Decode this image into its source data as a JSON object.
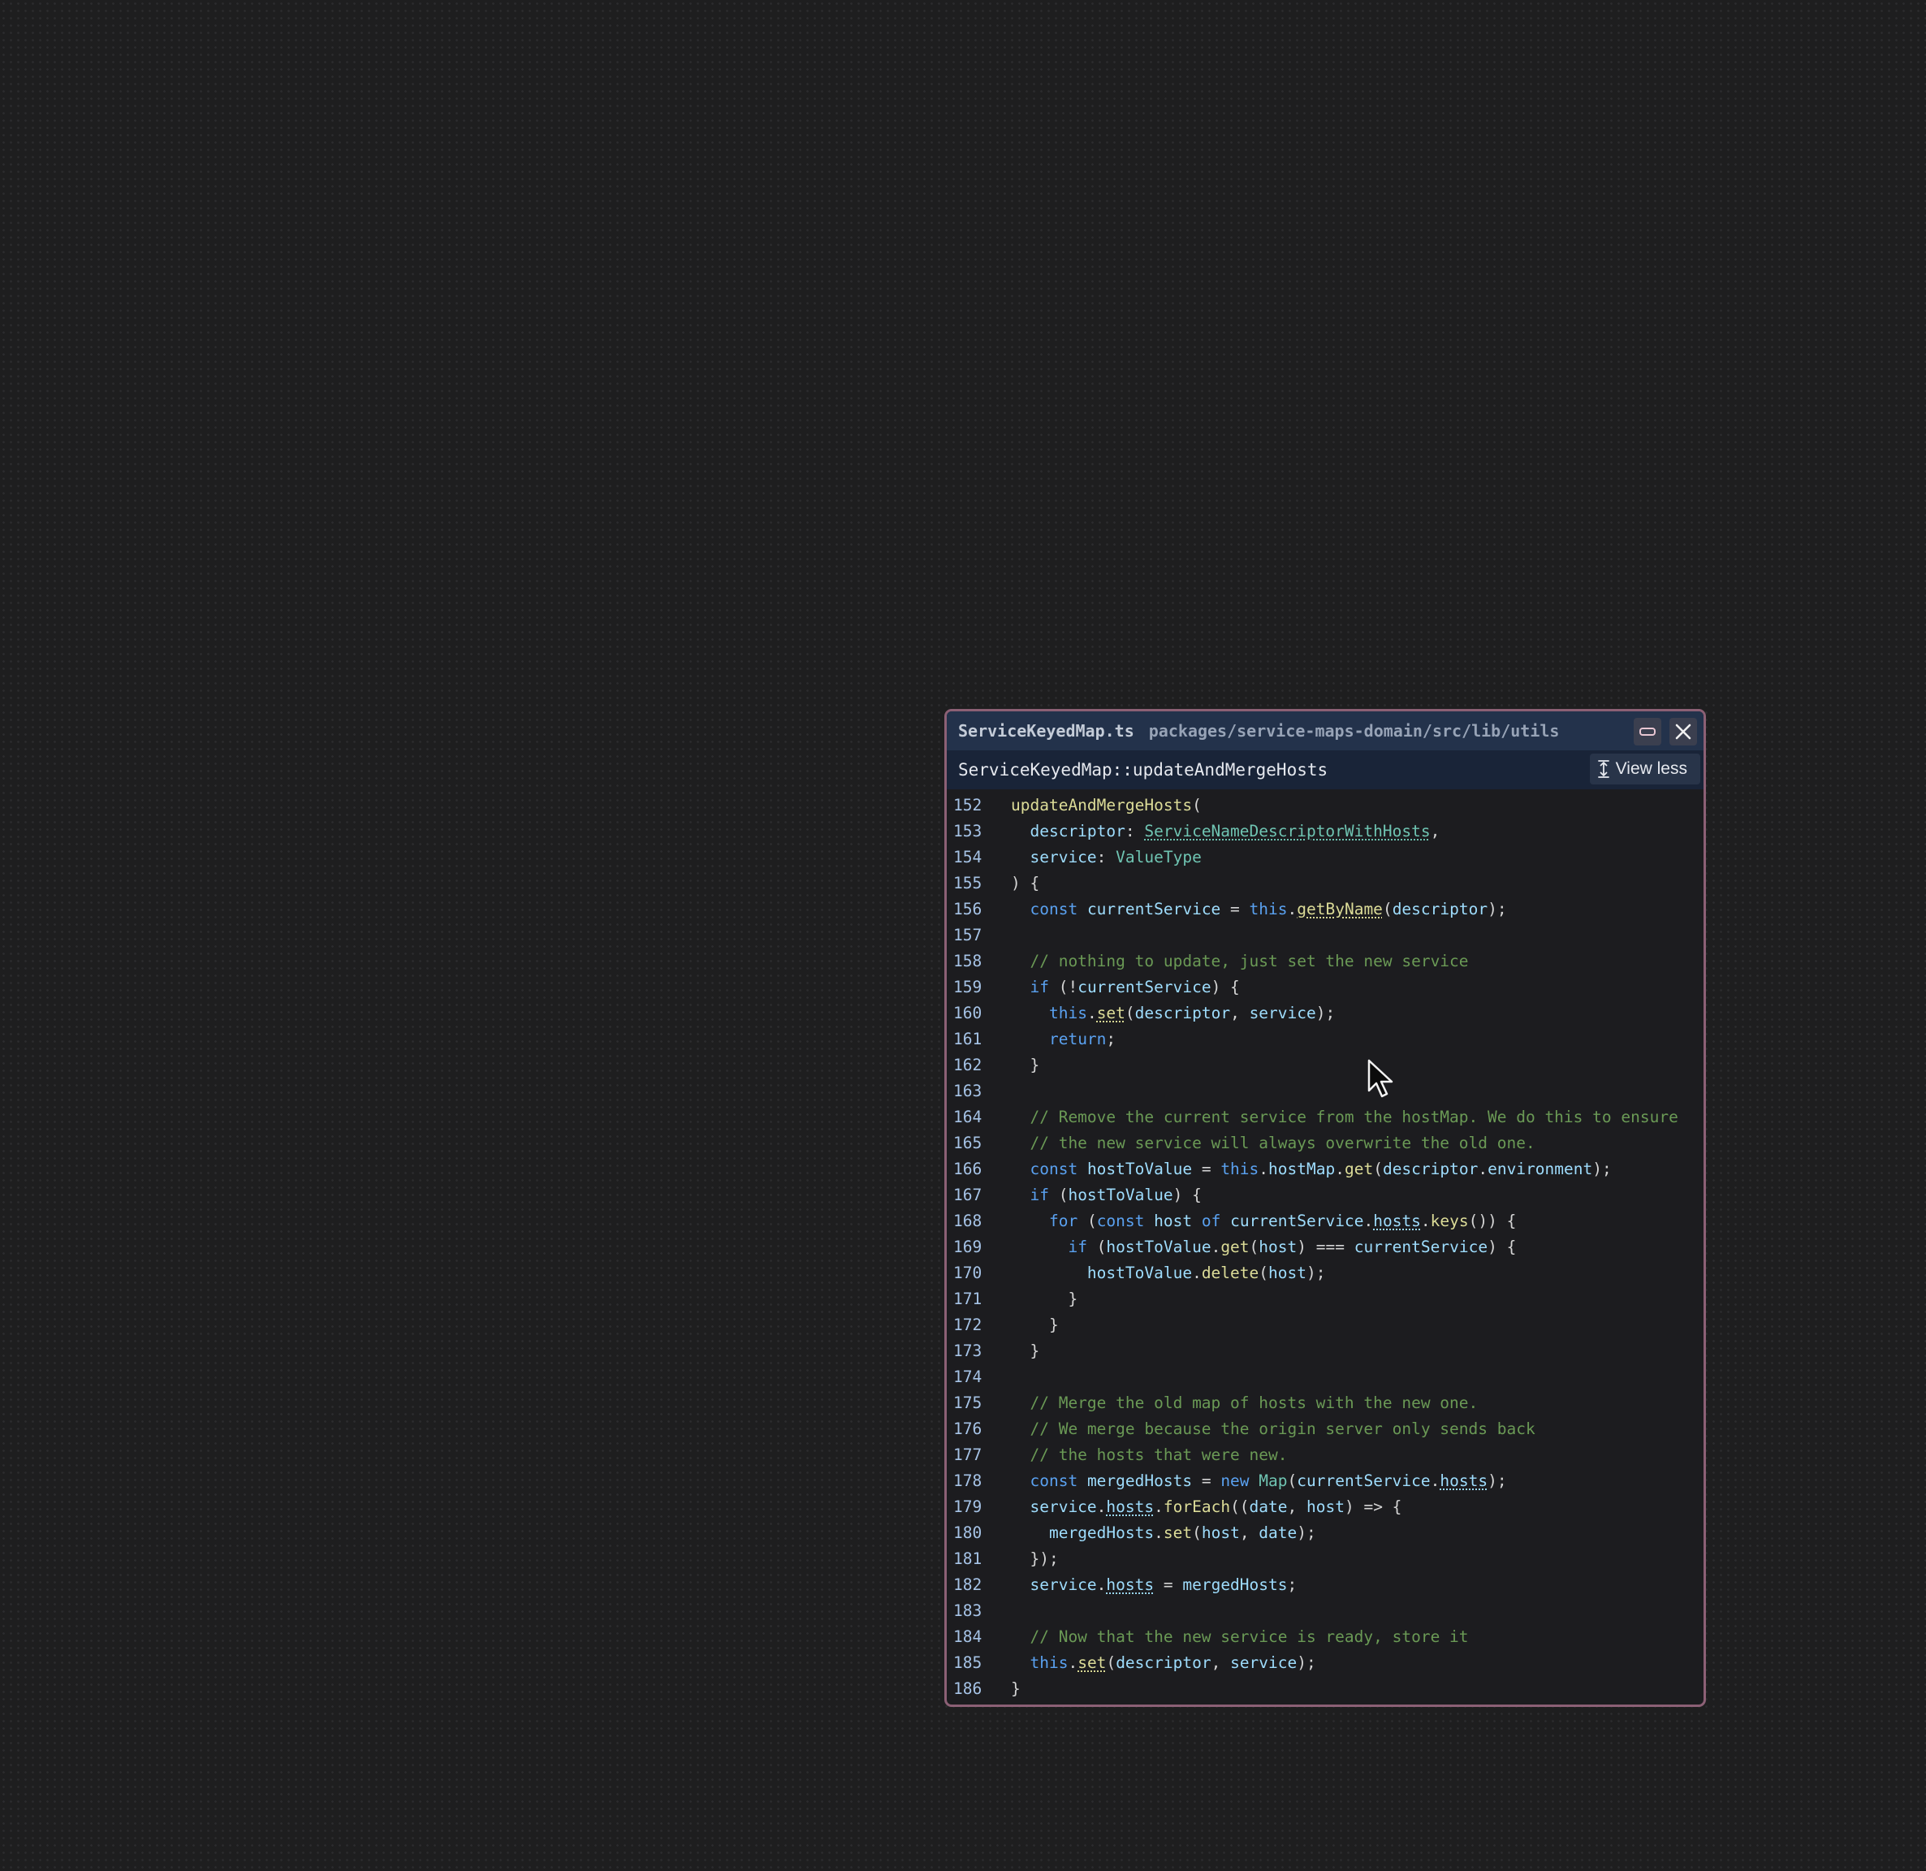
{
  "window": {
    "file_name": "ServiceKeyedMap.ts",
    "file_path": "packages/service-maps-domain/src/lib/utils",
    "symbol": "ServiceKeyedMap::updateAndMergeHosts",
    "view_less_label": "View less",
    "icons": {
      "minimize": "minimize-icon",
      "close": "close-icon",
      "collapse": "collapse-vertical-icon"
    }
  },
  "colors": {
    "keyword": "#5aa1f0",
    "function": "#dcdc98",
    "type": "#6fc4b2",
    "identifier": "#9edcfc",
    "comment": "#6a9955",
    "line_number": "#a6c3e6",
    "panel_border": "#8c6075"
  },
  "code": {
    "lines": [
      {
        "n": "152",
        "tokens": [
          [
            "fn",
            "updateAndMergeHosts"
          ],
          [
            "pu",
            "("
          ]
        ]
      },
      {
        "n": "153",
        "tokens": [
          [
            "pu",
            "  "
          ],
          [
            "id",
            "descriptor"
          ],
          [
            "pu",
            ": "
          ],
          [
            "tyu",
            "ServiceNameDescriptorWithHosts"
          ],
          [
            "pu",
            ","
          ]
        ]
      },
      {
        "n": "154",
        "tokens": [
          [
            "pu",
            "  "
          ],
          [
            "id",
            "service"
          ],
          [
            "pu",
            ": "
          ],
          [
            "ty",
            "ValueType"
          ]
        ]
      },
      {
        "n": "155",
        "tokens": [
          [
            "pu",
            ") {"
          ]
        ]
      },
      {
        "n": "156",
        "tokens": [
          [
            "pu",
            "  "
          ],
          [
            "kw",
            "const"
          ],
          [
            "pu",
            " "
          ],
          [
            "id",
            "currentService"
          ],
          [
            "pu",
            " = "
          ],
          [
            "kw",
            "this"
          ],
          [
            "pu",
            "."
          ],
          [
            "fnu",
            "getByName"
          ],
          [
            "pu",
            "("
          ],
          [
            "id",
            "descriptor"
          ],
          [
            "pu",
            ");"
          ]
        ]
      },
      {
        "n": "157",
        "tokens": []
      },
      {
        "n": "158",
        "tokens": [
          [
            "pu",
            "  "
          ],
          [
            "cm",
            "// nothing to update, just set the new service"
          ]
        ]
      },
      {
        "n": "159",
        "tokens": [
          [
            "pu",
            "  "
          ],
          [
            "kw",
            "if"
          ],
          [
            "pu",
            " (!"
          ],
          [
            "id",
            "currentService"
          ],
          [
            "pu",
            ") {"
          ]
        ]
      },
      {
        "n": "160",
        "tokens": [
          [
            "pu",
            "    "
          ],
          [
            "kw",
            "this"
          ],
          [
            "pu",
            "."
          ],
          [
            "fnu",
            "set"
          ],
          [
            "pu",
            "("
          ],
          [
            "id",
            "descriptor"
          ],
          [
            "pu",
            ", "
          ],
          [
            "id",
            "service"
          ],
          [
            "pu",
            ");"
          ]
        ]
      },
      {
        "n": "161",
        "tokens": [
          [
            "pu",
            "    "
          ],
          [
            "kw",
            "return"
          ],
          [
            "pu",
            ";"
          ]
        ]
      },
      {
        "n": "162",
        "tokens": [
          [
            "pu",
            "  }"
          ]
        ]
      },
      {
        "n": "163",
        "tokens": []
      },
      {
        "n": "164",
        "tokens": [
          [
            "pu",
            "  "
          ],
          [
            "cm",
            "// Remove the current service from the hostMap. We do this to ensure"
          ]
        ]
      },
      {
        "n": "165",
        "tokens": [
          [
            "pu",
            "  "
          ],
          [
            "cm",
            "// the new service will always overwrite the old one."
          ]
        ]
      },
      {
        "n": "166",
        "tokens": [
          [
            "pu",
            "  "
          ],
          [
            "kw",
            "const"
          ],
          [
            "pu",
            " "
          ],
          [
            "id",
            "hostToValue"
          ],
          [
            "pu",
            " = "
          ],
          [
            "kw",
            "this"
          ],
          [
            "pu",
            "."
          ],
          [
            "id",
            "hostMap"
          ],
          [
            "pu",
            "."
          ],
          [
            "fn",
            "get"
          ],
          [
            "pu",
            "("
          ],
          [
            "id",
            "descriptor"
          ],
          [
            "pu",
            "."
          ],
          [
            "id",
            "environment"
          ],
          [
            "pu",
            ");"
          ]
        ]
      },
      {
        "n": "167",
        "tokens": [
          [
            "pu",
            "  "
          ],
          [
            "kw",
            "if"
          ],
          [
            "pu",
            " ("
          ],
          [
            "id",
            "hostToValue"
          ],
          [
            "pu",
            ") {"
          ]
        ]
      },
      {
        "n": "168",
        "tokens": [
          [
            "pu",
            "    "
          ],
          [
            "kw",
            "for"
          ],
          [
            "pu",
            " ("
          ],
          [
            "kw",
            "const"
          ],
          [
            "pu",
            " "
          ],
          [
            "id",
            "host"
          ],
          [
            "pu",
            " "
          ],
          [
            "kw",
            "of"
          ],
          [
            "pu",
            " "
          ],
          [
            "id",
            "currentService"
          ],
          [
            "pu",
            "."
          ],
          [
            "idu",
            "hosts"
          ],
          [
            "pu",
            "."
          ],
          [
            "fn",
            "keys"
          ],
          [
            "pu",
            "()) {"
          ]
        ]
      },
      {
        "n": "169",
        "tokens": [
          [
            "pu",
            "      "
          ],
          [
            "kw",
            "if"
          ],
          [
            "pu",
            " ("
          ],
          [
            "id",
            "hostToValue"
          ],
          [
            "pu",
            "."
          ],
          [
            "fn",
            "get"
          ],
          [
            "pu",
            "("
          ],
          [
            "id",
            "host"
          ],
          [
            "pu",
            ") === "
          ],
          [
            "id",
            "currentService"
          ],
          [
            "pu",
            ") {"
          ]
        ]
      },
      {
        "n": "170",
        "tokens": [
          [
            "pu",
            "        "
          ],
          [
            "id",
            "hostToValue"
          ],
          [
            "pu",
            "."
          ],
          [
            "fn",
            "delete"
          ],
          [
            "pu",
            "("
          ],
          [
            "id",
            "host"
          ],
          [
            "pu",
            ");"
          ]
        ]
      },
      {
        "n": "171",
        "tokens": [
          [
            "pu",
            "      }"
          ]
        ]
      },
      {
        "n": "172",
        "tokens": [
          [
            "pu",
            "    }"
          ]
        ]
      },
      {
        "n": "173",
        "tokens": [
          [
            "pu",
            "  }"
          ]
        ]
      },
      {
        "n": "174",
        "tokens": []
      },
      {
        "n": "175",
        "tokens": [
          [
            "pu",
            "  "
          ],
          [
            "cm",
            "// Merge the old map of hosts with the new one."
          ]
        ]
      },
      {
        "n": "176",
        "tokens": [
          [
            "pu",
            "  "
          ],
          [
            "cm",
            "// We merge because the origin server only sends back"
          ]
        ]
      },
      {
        "n": "177",
        "tokens": [
          [
            "pu",
            "  "
          ],
          [
            "cm",
            "// the hosts that were new."
          ]
        ]
      },
      {
        "n": "178",
        "tokens": [
          [
            "pu",
            "  "
          ],
          [
            "kw",
            "const"
          ],
          [
            "pu",
            " "
          ],
          [
            "id",
            "mergedHosts"
          ],
          [
            "pu",
            " = "
          ],
          [
            "kw",
            "new"
          ],
          [
            "pu",
            " "
          ],
          [
            "ty",
            "Map"
          ],
          [
            "pu",
            "("
          ],
          [
            "id",
            "currentService"
          ],
          [
            "pu",
            "."
          ],
          [
            "idu",
            "hosts"
          ],
          [
            "pu",
            ");"
          ]
        ]
      },
      {
        "n": "179",
        "tokens": [
          [
            "pu",
            "  "
          ],
          [
            "id",
            "service"
          ],
          [
            "pu",
            "."
          ],
          [
            "idu",
            "hosts"
          ],
          [
            "pu",
            "."
          ],
          [
            "fn",
            "forEach"
          ],
          [
            "pu",
            "(("
          ],
          [
            "id",
            "date"
          ],
          [
            "pu",
            ", "
          ],
          [
            "id",
            "host"
          ],
          [
            "pu",
            ") => {"
          ]
        ]
      },
      {
        "n": "180",
        "tokens": [
          [
            "pu",
            "    "
          ],
          [
            "id",
            "mergedHosts"
          ],
          [
            "pu",
            "."
          ],
          [
            "fn",
            "set"
          ],
          [
            "pu",
            "("
          ],
          [
            "id",
            "host"
          ],
          [
            "pu",
            ", "
          ],
          [
            "id",
            "date"
          ],
          [
            "pu",
            ");"
          ]
        ]
      },
      {
        "n": "181",
        "tokens": [
          [
            "pu",
            "  });"
          ]
        ]
      },
      {
        "n": "182",
        "tokens": [
          [
            "pu",
            "  "
          ],
          [
            "id",
            "service"
          ],
          [
            "pu",
            "."
          ],
          [
            "idu",
            "hosts"
          ],
          [
            "pu",
            " = "
          ],
          [
            "id",
            "mergedHosts"
          ],
          [
            "pu",
            ";"
          ]
        ]
      },
      {
        "n": "183",
        "tokens": []
      },
      {
        "n": "184",
        "tokens": [
          [
            "pu",
            "  "
          ],
          [
            "cm",
            "// Now that the new service is ready, store it"
          ]
        ]
      },
      {
        "n": "185",
        "tokens": [
          [
            "pu",
            "  "
          ],
          [
            "kw",
            "this"
          ],
          [
            "pu",
            "."
          ],
          [
            "fnu",
            "set"
          ],
          [
            "pu",
            "("
          ],
          [
            "id",
            "descriptor"
          ],
          [
            "pu",
            ", "
          ],
          [
            "id",
            "service"
          ],
          [
            "pu",
            ");"
          ]
        ]
      },
      {
        "n": "186",
        "tokens": [
          [
            "pu",
            "}"
          ]
        ]
      }
    ]
  },
  "cursor": {
    "icon": "mouse-pointer-icon"
  }
}
